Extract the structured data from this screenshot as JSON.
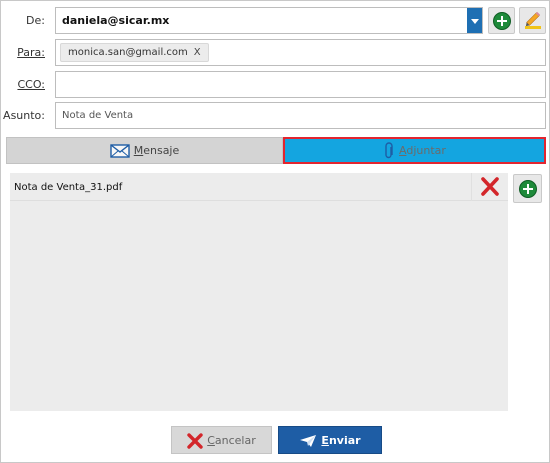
{
  "labels": {
    "de": "De:",
    "para": "Para:",
    "cco": "CCO:",
    "asunto": "Asunto:"
  },
  "from": {
    "value": "daniela@sicar.mx"
  },
  "to": {
    "chips": [
      {
        "email": "monica.san@gmail.com",
        "remove": "X"
      }
    ]
  },
  "cco": {
    "value": ""
  },
  "subject": {
    "value": "Nota de Venta"
  },
  "tabs": {
    "mensaje": {
      "underlined": "M",
      "rest": "ensaje"
    },
    "adjuntar": {
      "underlined": "A",
      "rest": "djuntar"
    },
    "active": "adjuntar"
  },
  "attachments": [
    {
      "name": "Nota de Venta_31.pdf"
    }
  ],
  "buttons": {
    "cancel": {
      "underlined": "C",
      "rest": "ancelar"
    },
    "send": {
      "underlined": "E",
      "rest": "nviar"
    }
  },
  "icons": {
    "add_sender": "plus-circle-icon",
    "edit_sender": "pencil-icon",
    "mensaje_tab": "envelope-icon",
    "adjuntar_tab": "paperclip-icon",
    "delete_attachment": "red-x-icon",
    "add_attachment": "plus-circle-icon",
    "cancel": "red-x-icon",
    "send": "paper-plane-icon"
  },
  "colors": {
    "accent_blue": "#1e6fb3",
    "active_tab": "#14a5e0",
    "active_tab_border": "#e3252f",
    "send_button": "#1e5da5",
    "add_green": "#1e8a3a",
    "delete_red": "#d3262b"
  }
}
